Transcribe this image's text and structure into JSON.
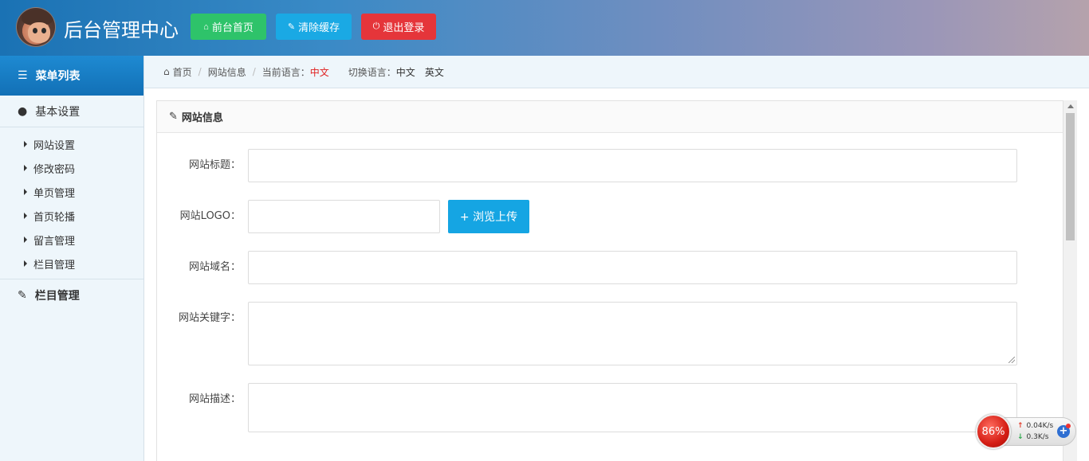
{
  "header": {
    "title": "后台管理中心",
    "buttons": {
      "home": "前台首页",
      "clear_cache": "清除缓存",
      "logout": "退出登录"
    }
  },
  "sidebar": {
    "menu_title": "菜单列表",
    "groups": [
      {
        "label": "基本设置",
        "items": [
          "网站设置",
          "修改密码",
          "单页管理",
          "首页轮播",
          "留言管理",
          "栏目管理"
        ]
      },
      {
        "label": "栏目管理"
      }
    ]
  },
  "breadcrumb": {
    "home": "首页",
    "page": "网站信息",
    "current_lang_label": "当前语言：",
    "current_lang": "中文",
    "switch_lang_label": "切换语言：",
    "lang_zh": "中文",
    "lang_en": "英文"
  },
  "panel": {
    "title": "网站信息",
    "fields": {
      "site_title": {
        "label": "网站标题：",
        "value": ""
      },
      "site_logo": {
        "label": "网站LOGO：",
        "value": "",
        "upload_label": "+ 浏览上传"
      },
      "site_domain": {
        "label": "网站域名：",
        "value": ""
      },
      "site_keywords": {
        "label": "网站关键字：",
        "value": ""
      },
      "site_description": {
        "label": "网站描述：",
        "value": ""
      }
    }
  },
  "network_widget": {
    "percent": "86%",
    "upload_speed": "0.04K/s",
    "download_speed": "0.3K/s"
  },
  "colors": {
    "green_button": "#2ec36a",
    "blue_button": "#1aa9e4",
    "red_button": "#e5353a",
    "sidebar_title": "#1a7cc4",
    "current_lang": "#e02020"
  }
}
